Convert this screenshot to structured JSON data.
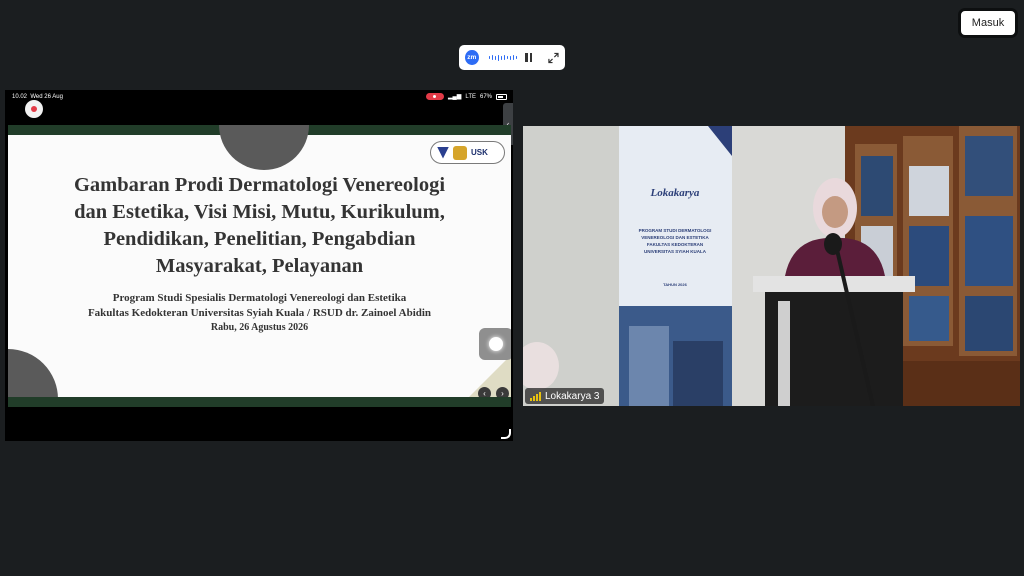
{
  "toolbar": {
    "join_label": "Masuk"
  },
  "zoom_control": {
    "logo_text": "zm"
  },
  "shared_screen": {
    "status_time": "10.02",
    "status_date": "Wed 26 Aug",
    "network": "LTE",
    "battery": "67%",
    "slide": {
      "title_lines": [
        "Gambaran Prodi Dermatologi Venereologi",
        "dan Estetika, Visi Misi, Mutu, Kurikulum,",
        "Pendidikan, Penelitian, Pengabdian",
        "Masyarakat, Pelayanan"
      ],
      "subtitle_1": "Program Studi Spesialis Dermatologi Venereologi dan Estetika",
      "subtitle_2": "Fakultas Kedokteran Universitas Syiah Kuala / RSUD dr. Zainoel Abidin",
      "date": "Rabu, 26 Agustus 2026",
      "logo_text": "USK"
    }
  },
  "video": {
    "participant_name": "Lokakarya 3",
    "banner_heading": "Lokakarya",
    "banner_lines": [
      "PROGRAM STUDI DERMATOLOGI",
      "VENEREOLOGI DAN ESTETIKA",
      "FAKULTAS KEDOKTERAN",
      "UNIVERSITAS SYIAH KUALA"
    ],
    "banner_year": "TAHUN 2026"
  },
  "colors": {
    "background": "#1b1e20",
    "zoom_blue": "#2d6cf5",
    "slide_green": "#213d29",
    "record_red": "#e23a47"
  }
}
